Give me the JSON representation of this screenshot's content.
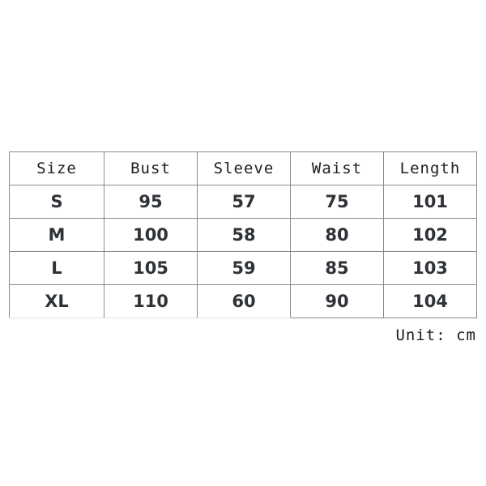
{
  "table": {
    "headers": [
      "Size",
      "Bust",
      "Sleeve",
      "Waist",
      "Length"
    ],
    "rows": [
      {
        "size": "S",
        "bust": "95",
        "sleeve": "57",
        "waist": "75",
        "length": "101"
      },
      {
        "size": "M",
        "bust": "100",
        "sleeve": "58",
        "waist": "80",
        "length": "102"
      },
      {
        "size": "L",
        "bust": "105",
        "sleeve": "59",
        "waist": "85",
        "length": "103"
      },
      {
        "size": "XL",
        "bust": "110",
        "sleeve": "60",
        "waist": "90",
        "length": "104"
      }
    ]
  },
  "unit_note": "Unit: cm",
  "colors": {
    "background": "#ffffff",
    "border": "#8a8a8a",
    "border_faded": "#e4e4e4",
    "header_text": "#1d1d1d",
    "cell_text": "#2f3338"
  }
}
